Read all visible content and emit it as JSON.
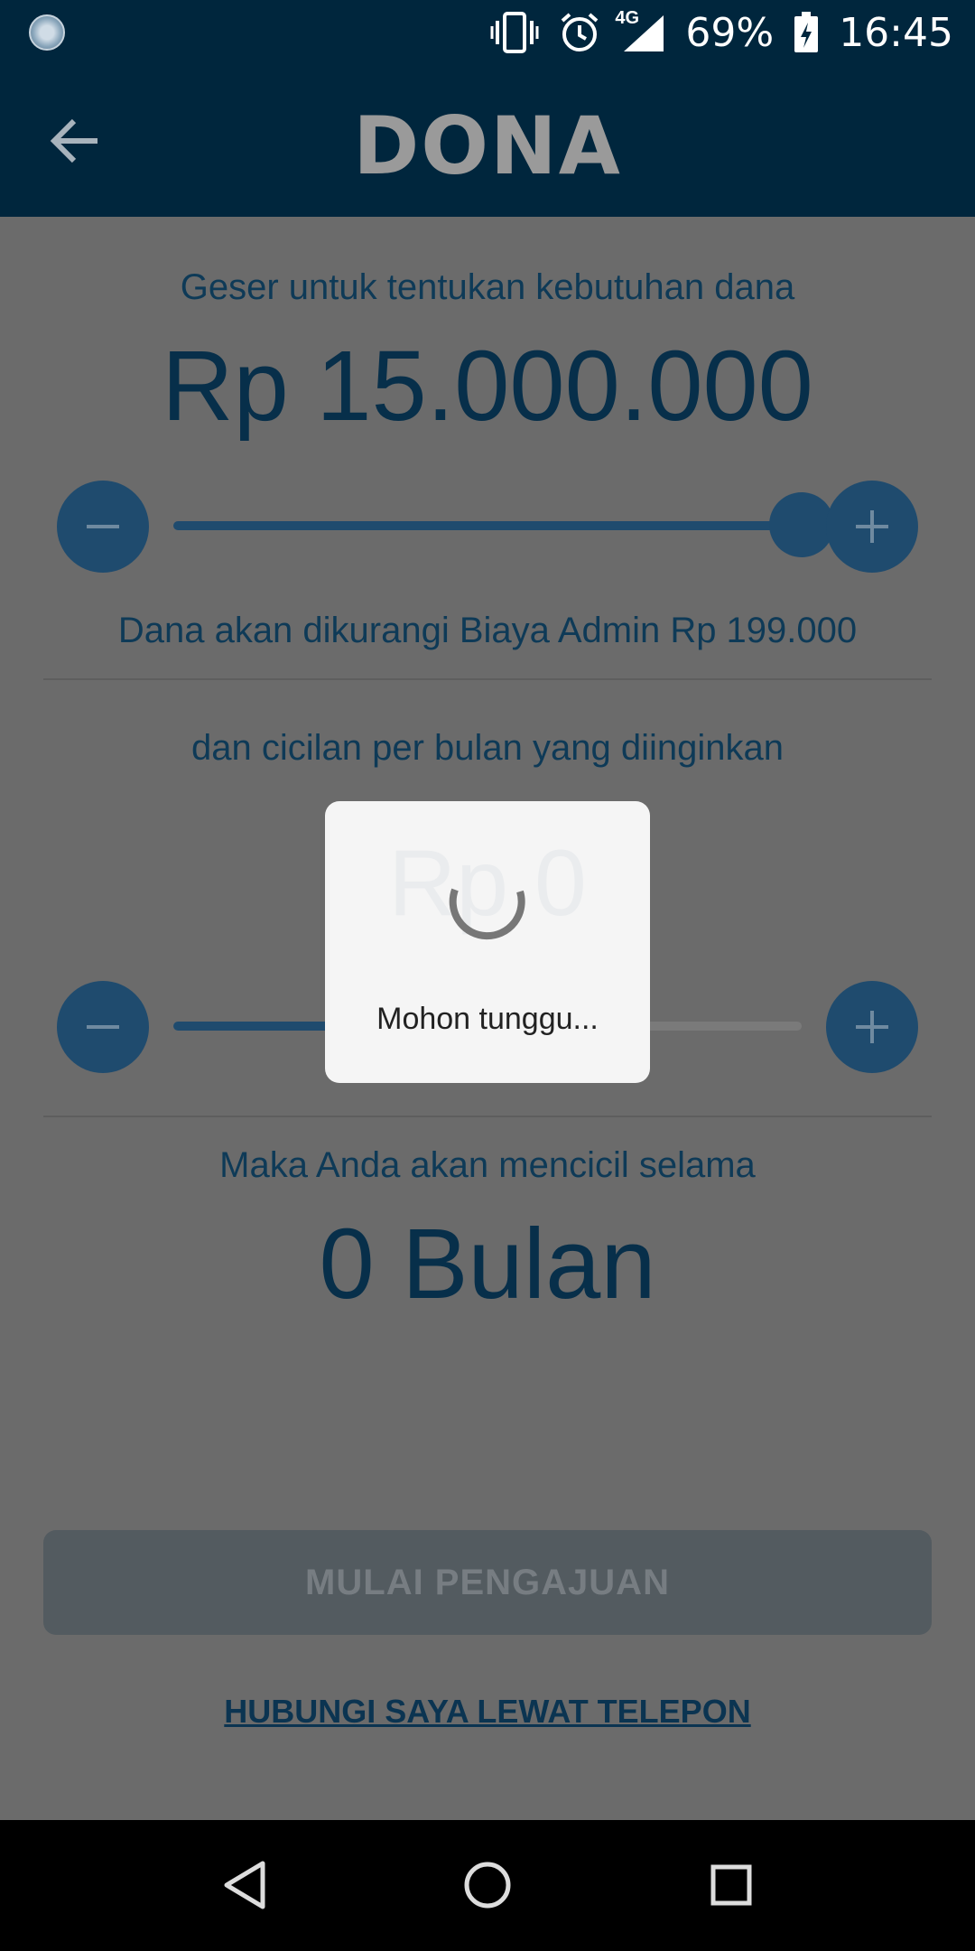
{
  "status_bar": {
    "battery": "69%",
    "time": "16:45",
    "network": "4G",
    "icons": [
      "app-notification-icon",
      "vibrate-icon",
      "alarm-icon",
      "signal-icon",
      "battery-charging-icon"
    ]
  },
  "app_bar": {
    "title": "DONA",
    "back_icon": "arrow-back-icon"
  },
  "loan": {
    "slider_label": "Geser untuk tentukan kebutuhan dana",
    "amount": "Rp 15.000.000",
    "amount_level": 1.0,
    "admin_fee_note": "Dana akan dikurangi Biaya Admin Rp 199.000"
  },
  "installment": {
    "label": "dan cicilan per bulan yang diinginkan",
    "amount": "Rp 0",
    "level": 0.7
  },
  "duration": {
    "label": "Maka Anda akan mencicil selama",
    "value": "0 Bulan"
  },
  "actions": {
    "primary_label": "MULAI PENGAJUAN",
    "call_link": "HUBUNGI SAYA LEWAT TELEPON"
  },
  "dialog": {
    "message": "Mohon tunggu..."
  },
  "colors": {
    "header": "#00263d",
    "accent": "#1f4b6e",
    "text": "#0e3a57"
  }
}
